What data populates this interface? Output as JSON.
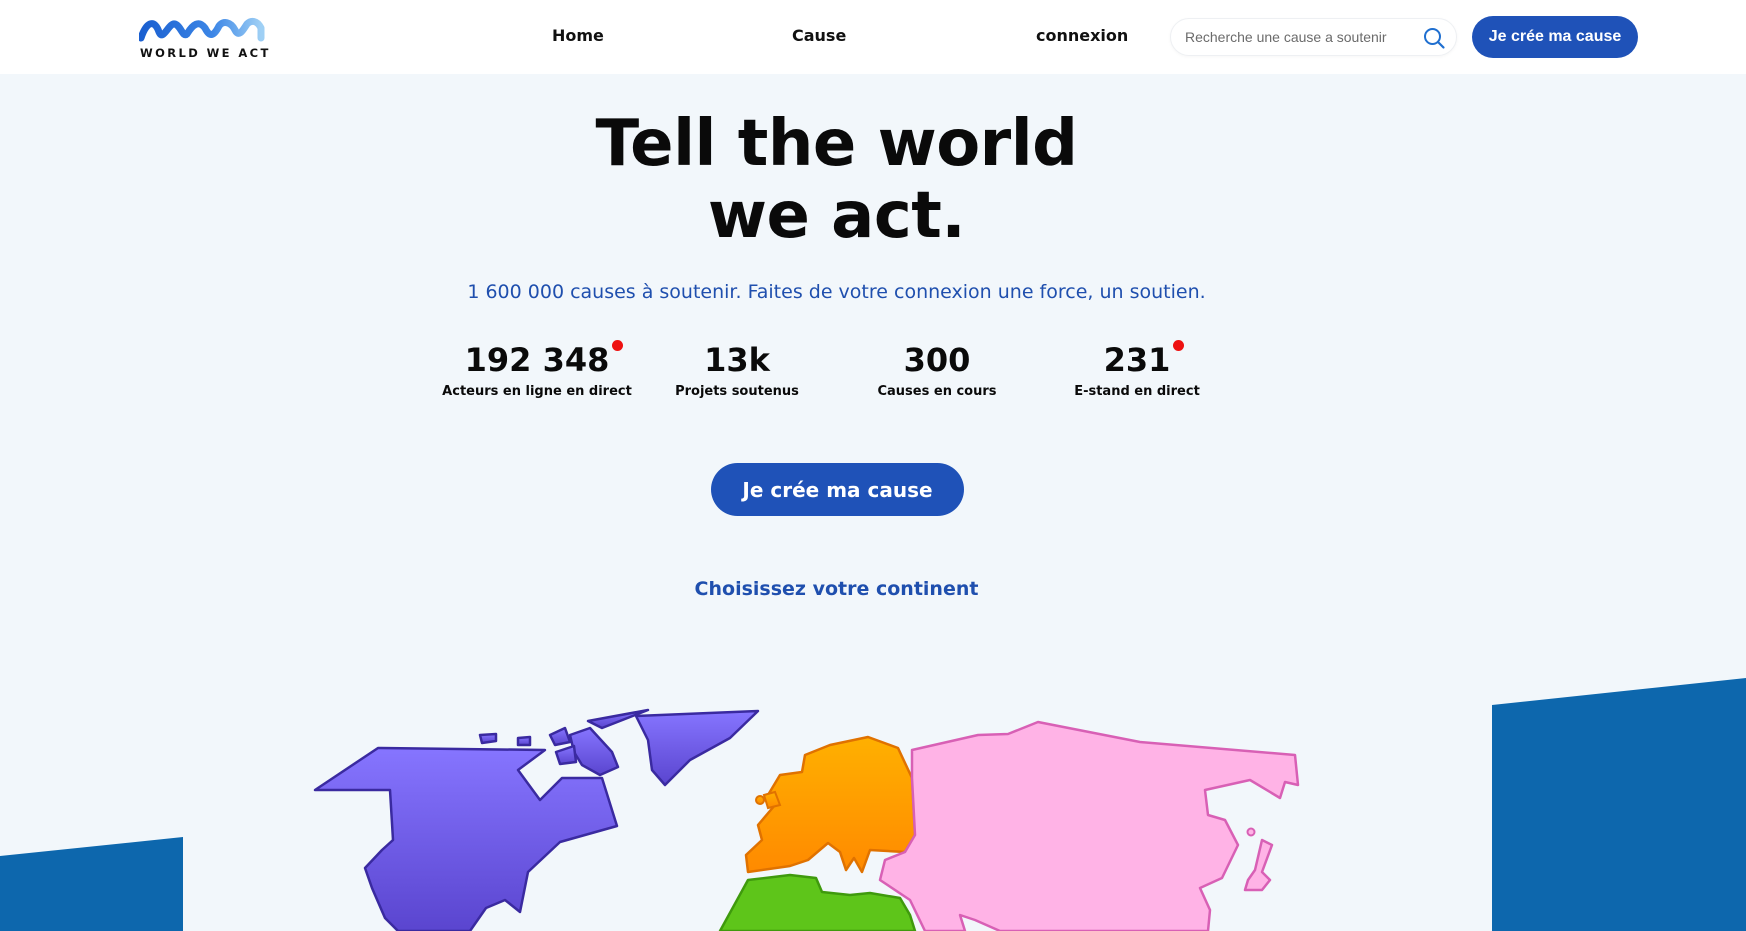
{
  "header": {
    "logo_text": "WORLD WE ACT",
    "nav": {
      "home": "Home",
      "cause": "Cause",
      "connexion": "connexion"
    },
    "search": {
      "placeholder": "Recherche une cause a soutenir"
    },
    "cta_label": "Je crée ma cause"
  },
  "hero": {
    "title_line1": "Tell the world",
    "title_line2": "we act.",
    "subtitle": "1 600 000 causes à soutenir. Faites de votre connexion une force, un soutien.",
    "stats": [
      {
        "value": "192 348",
        "label": "Acteurs en ligne en direct",
        "live": true
      },
      {
        "value": "13k",
        "label": "Projets soutenus",
        "live": false
      },
      {
        "value": "300",
        "label": "Causes en cours",
        "live": false
      },
      {
        "value": "231",
        "label": "E-stand en direct",
        "live": true
      }
    ],
    "cta_label": "Je crée ma cause",
    "continent_prompt": "Choisissez votre continent"
  },
  "colors": {
    "primary": "#1f52b8",
    "subtitle": "#1f4fae",
    "live_dot": "#ee1111",
    "north_america": "#7a68f0",
    "europe": "#ff9a00",
    "asia": "#ffb3e6",
    "africa": "#5ec51a",
    "band": "#0d67ad"
  },
  "map": {
    "regions": [
      "north-america",
      "europe",
      "asia",
      "africa"
    ]
  }
}
